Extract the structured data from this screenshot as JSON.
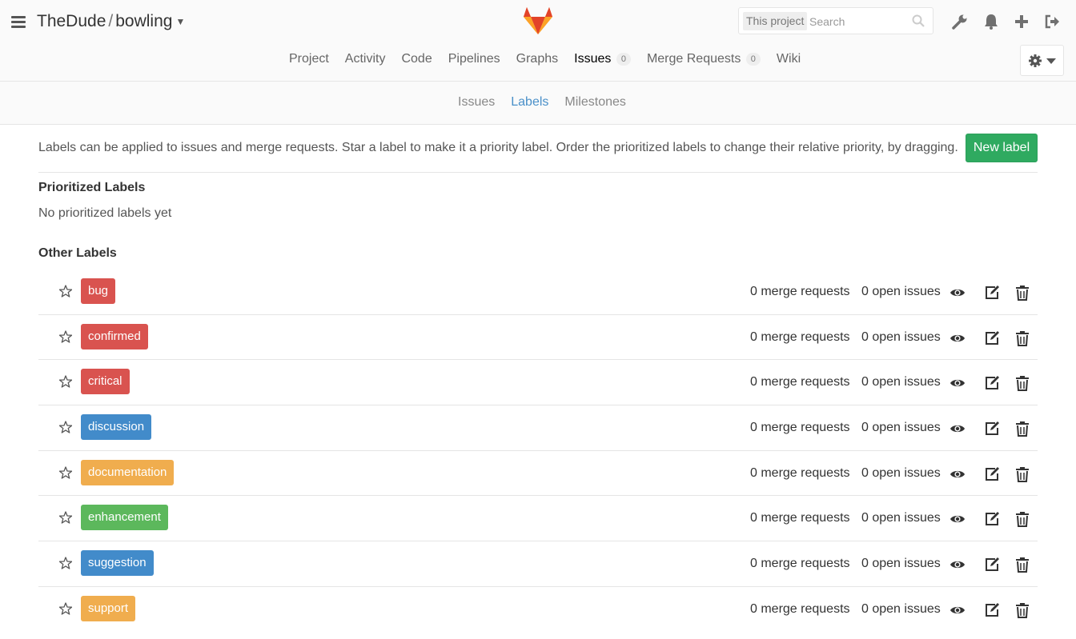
{
  "header": {
    "namespace": "TheDude",
    "separator": "/",
    "project": "bowling",
    "search": {
      "scope": "This project",
      "placeholder": "Search"
    }
  },
  "nav": {
    "items": [
      {
        "label": "Project"
      },
      {
        "label": "Activity"
      },
      {
        "label": "Code"
      },
      {
        "label": "Pipelines"
      },
      {
        "label": "Graphs"
      },
      {
        "label": "Issues",
        "count": "0",
        "active": true
      },
      {
        "label": "Merge Requests",
        "count": "0"
      },
      {
        "label": "Wiki"
      }
    ]
  },
  "subnav": {
    "items": [
      {
        "label": "Issues"
      },
      {
        "label": "Labels",
        "active": true
      },
      {
        "label": "Milestones"
      }
    ]
  },
  "content": {
    "intro": "Labels can be applied to issues and merge requests. Star a label to make it a priority label. Order the prioritized labels to change their relative priority, by dragging.",
    "new_label_button": "New label",
    "prioritized_heading": "Prioritized Labels",
    "no_prioritized": "No prioritized labels yet",
    "other_heading": "Other Labels"
  },
  "labels": [
    {
      "name": "bug",
      "color": "#d9534f",
      "merge_requests": "0 merge requests",
      "open_issues": "0 open issues"
    },
    {
      "name": "confirmed",
      "color": "#d9534f",
      "merge_requests": "0 merge requests",
      "open_issues": "0 open issues"
    },
    {
      "name": "critical",
      "color": "#d9534f",
      "merge_requests": "0 merge requests",
      "open_issues": "0 open issues"
    },
    {
      "name": "discussion",
      "color": "#428bca",
      "merge_requests": "0 merge requests",
      "open_issues": "0 open issues"
    },
    {
      "name": "documentation",
      "color": "#f0ad4e",
      "merge_requests": "0 merge requests",
      "open_issues": "0 open issues"
    },
    {
      "name": "enhancement",
      "color": "#5cb85c",
      "merge_requests": "0 merge requests",
      "open_issues": "0 open issues"
    },
    {
      "name": "suggestion",
      "color": "#428bca",
      "merge_requests": "0 merge requests",
      "open_issues": "0 open issues"
    },
    {
      "name": "support",
      "color": "#f0ad4e",
      "merge_requests": "0 merge requests",
      "open_issues": "0 open issues"
    }
  ],
  "icons": {
    "menu": "hamburger-icon",
    "logo": "gitlab-logo",
    "search": "search-icon",
    "admin": "wrench-icon",
    "notifications": "bell-icon",
    "new": "plus-icon",
    "sign_out": "sign-out-icon",
    "settings": "gear-icon",
    "star": "star-icon",
    "subscribe": "eye-icon",
    "edit": "edit-icon",
    "delete": "trash-icon"
  }
}
